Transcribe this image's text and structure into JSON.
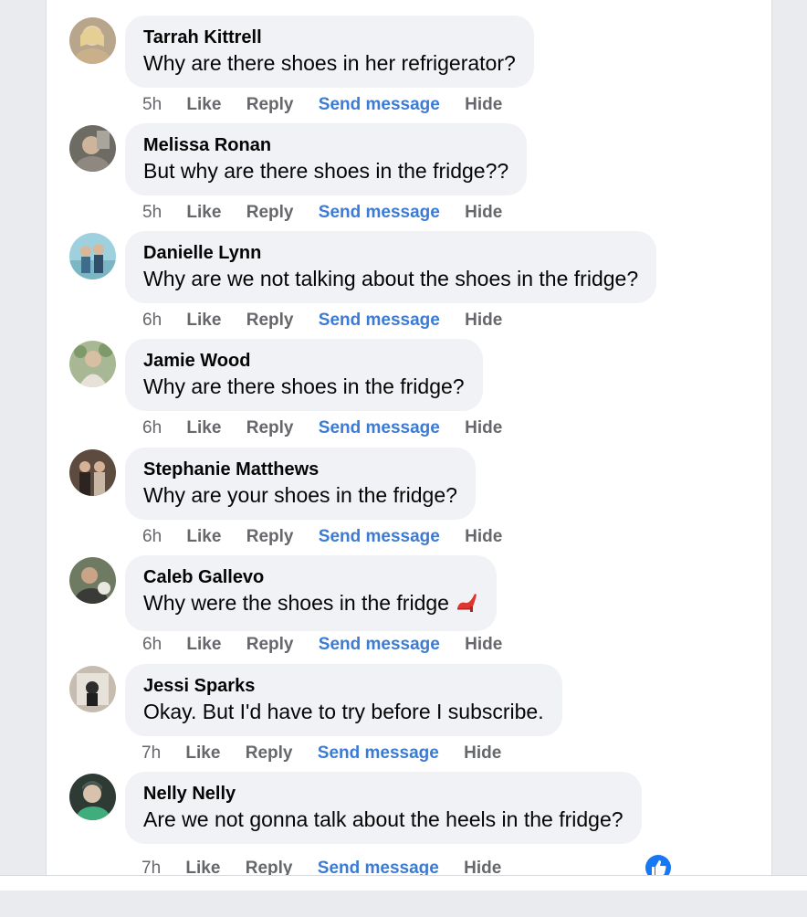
{
  "actions": {
    "like": "Like",
    "reply": "Reply",
    "send_message": "Send message",
    "hide": "Hide"
  },
  "comments": [
    {
      "author": "Tarrah Kittrell",
      "text": "Why are there shoes in her refrigerator?",
      "time": "5h"
    },
    {
      "author": "Melissa Ronan",
      "text": "But why are there shoes in the fridge??",
      "time": "5h"
    },
    {
      "author": "Danielle Lynn",
      "text": "Why are we not talking about the shoes in the fridge?",
      "time": "6h"
    },
    {
      "author": "Jamie Wood",
      "text": "Why are there shoes in the fridge?",
      "time": "6h"
    },
    {
      "author": "Stephanie Matthews",
      "text": "Why are your shoes in the fridge?",
      "time": "6h"
    },
    {
      "author": "Caleb Gallevo",
      "text": "Why were the shoes in the fridge",
      "time": "6h",
      "emoji": "high-heel-icon"
    },
    {
      "author": "Jessi Sparks",
      "text": "Okay. But I'd have to try before I subscribe.",
      "time": "7h"
    },
    {
      "author": "Nelly Nelly",
      "text": "Are we not gonna talk about the heels in the fridge?",
      "time": "7h",
      "reaction": "like-reaction-icon"
    }
  ],
  "colors": {
    "link": "#3b7bd4",
    "meta": "#65676b",
    "bubble": "#f0f2f5",
    "like_reaction": "#1877f2"
  }
}
